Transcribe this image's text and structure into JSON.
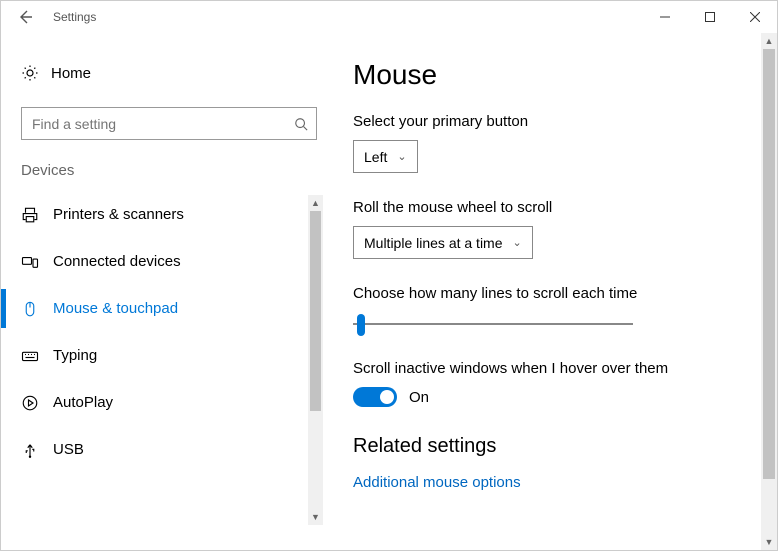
{
  "window": {
    "title": "Settings"
  },
  "sidebar": {
    "home_label": "Home",
    "search_placeholder": "Find a setting",
    "section_label": "Devices",
    "items": [
      {
        "label": "Printers & scanners"
      },
      {
        "label": "Connected devices"
      },
      {
        "label": "Mouse & touchpad"
      },
      {
        "label": "Typing"
      },
      {
        "label": "AutoPlay"
      },
      {
        "label": "USB"
      }
    ]
  },
  "page": {
    "title": "Mouse",
    "primary_button": {
      "label": "Select your primary button",
      "value": "Left"
    },
    "wheel_scroll": {
      "label": "Roll the mouse wheel to scroll",
      "value": "Multiple lines at a time"
    },
    "lines_slider": {
      "label": "Choose how many lines to scroll each time"
    },
    "inactive_scroll": {
      "label": "Scroll inactive windows when I hover over them",
      "state": "On"
    },
    "related": {
      "heading": "Related settings",
      "link": "Additional mouse options"
    }
  }
}
